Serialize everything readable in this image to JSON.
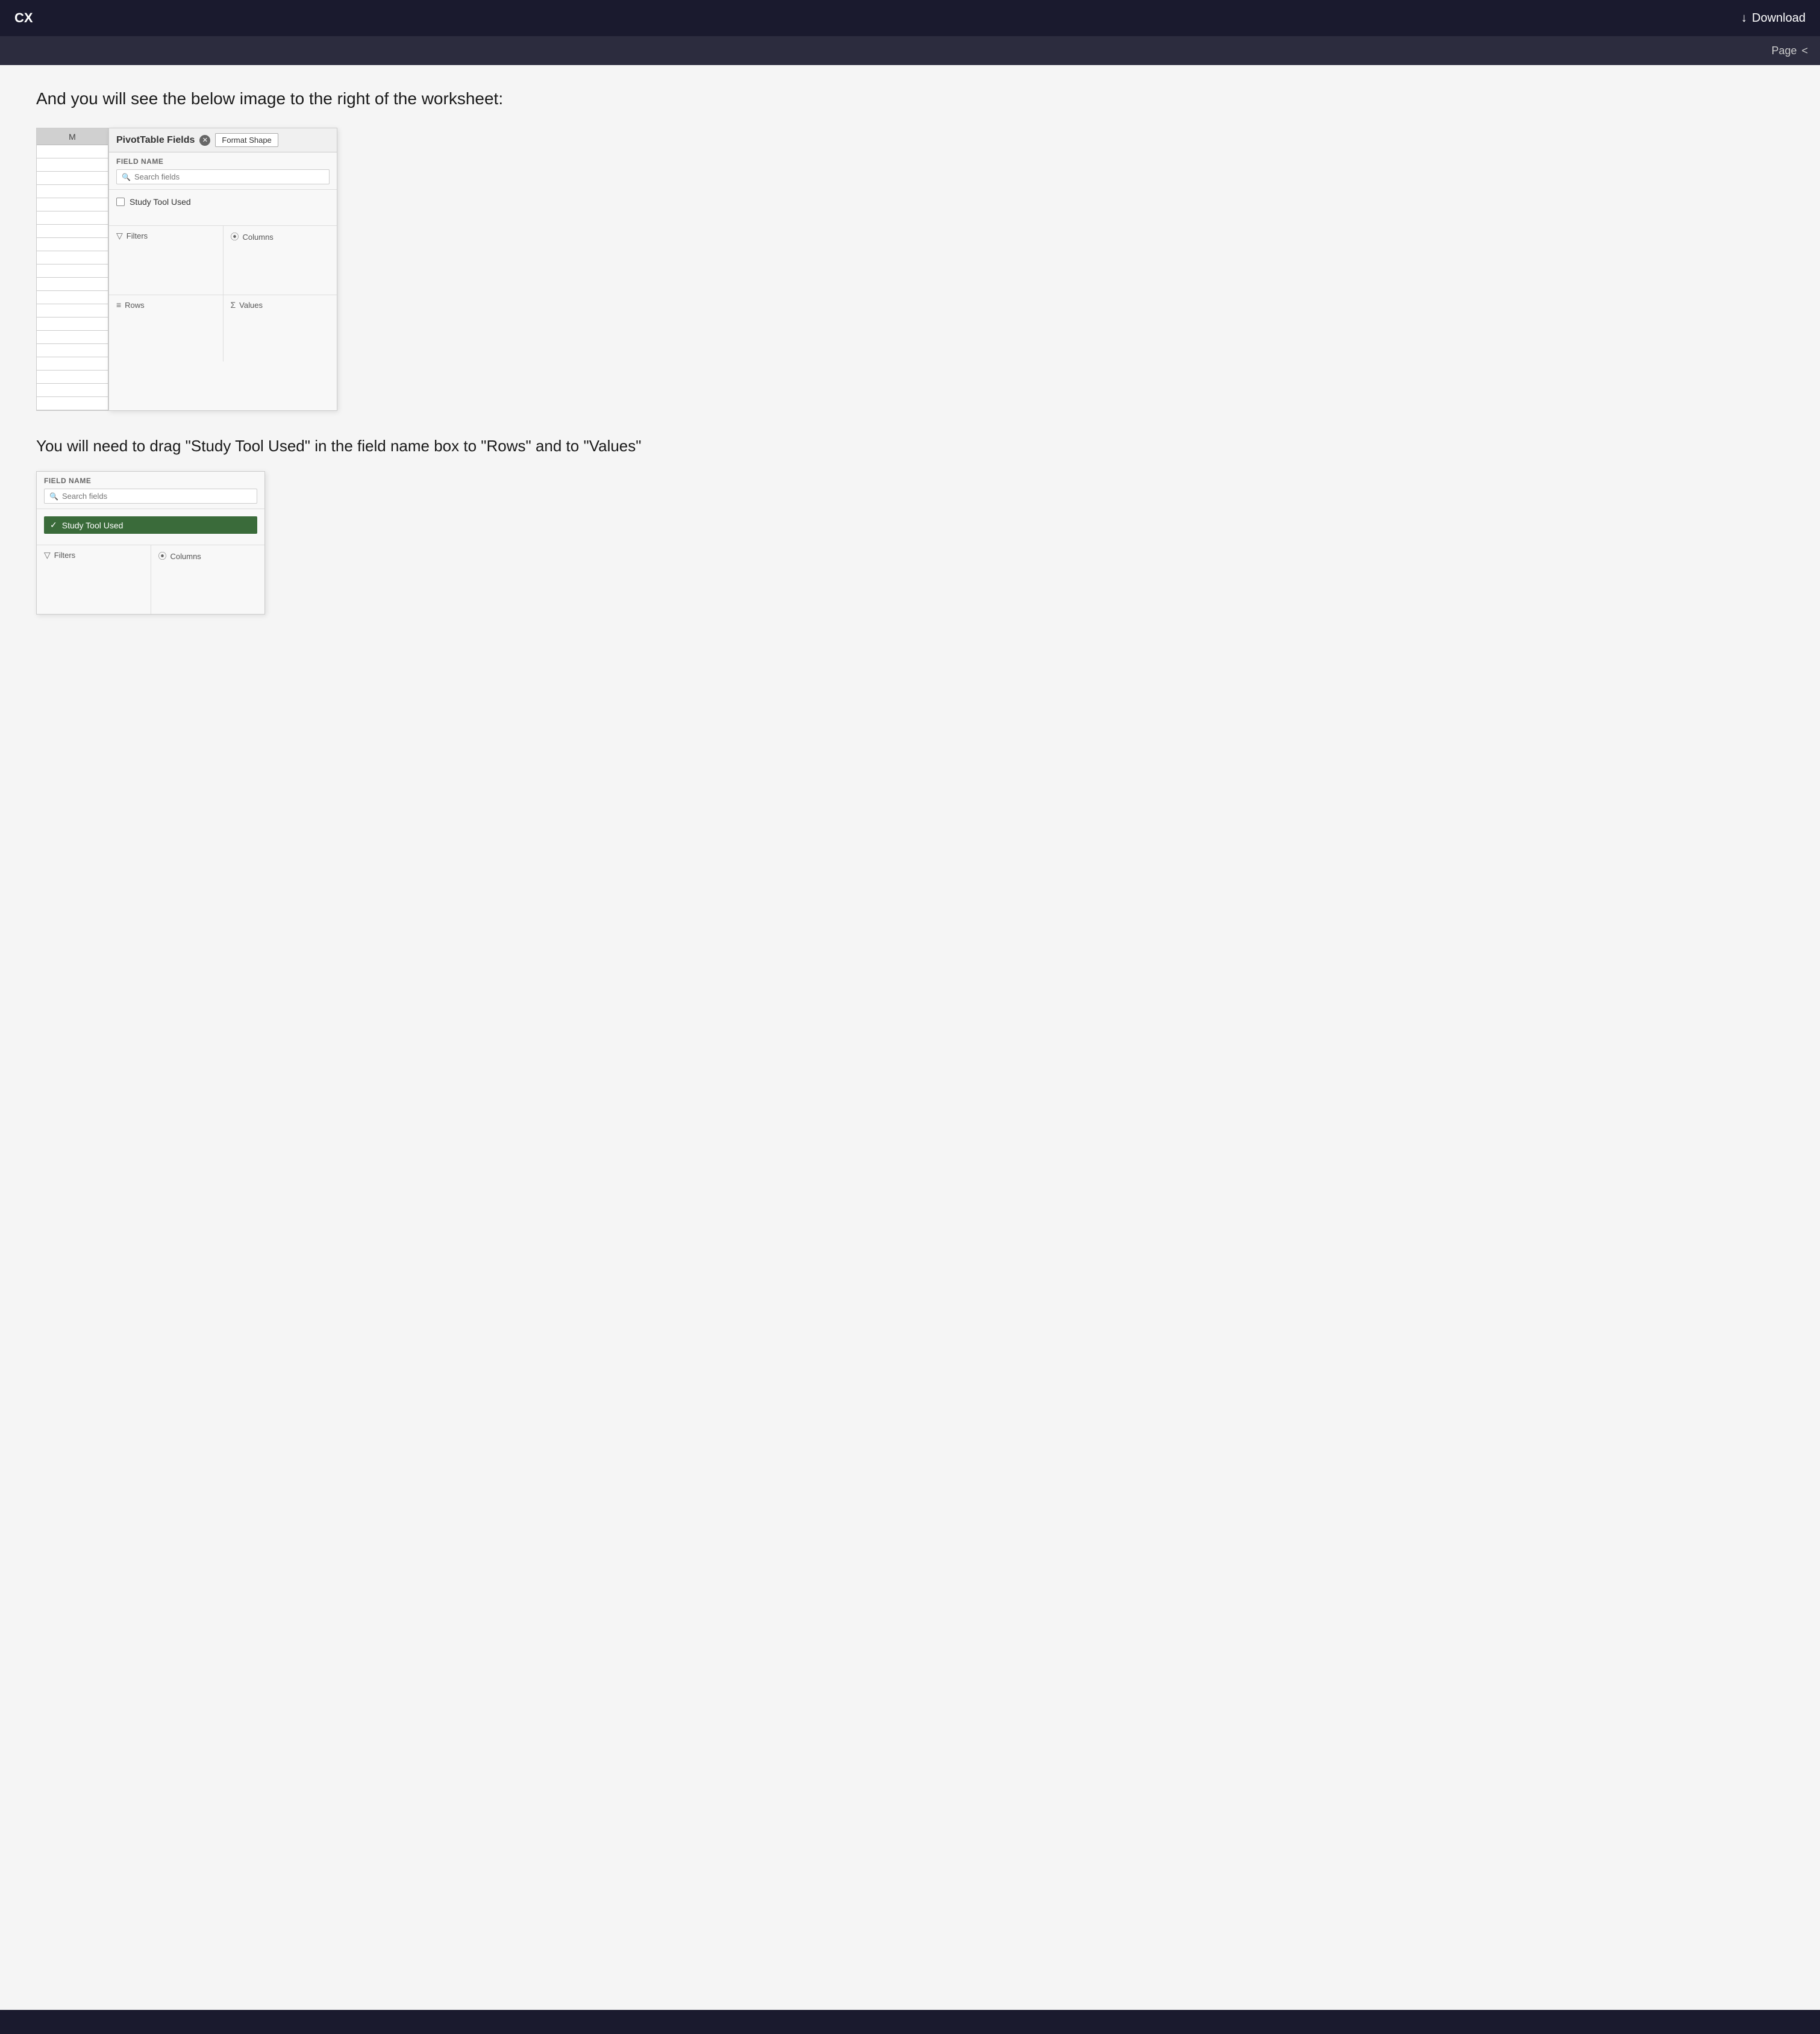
{
  "header": {
    "left_label": "CX",
    "download_label": "Download",
    "download_icon": "↓",
    "page_label": "Page",
    "chevron": "<"
  },
  "intro": {
    "text": "And you will see the below image to the right of the worksheet:"
  },
  "pivot_panel_1": {
    "title": "PivotTable Fields",
    "format_shape_label": "Format Shape",
    "field_name_label": "FIELD NAME",
    "search_placeholder": "Search fields",
    "field_item": "Study Tool Used",
    "filters_label": "Filters",
    "columns_label": "Columns",
    "rows_label": "Rows",
    "values_label": "Values",
    "col_header": "M"
  },
  "instruction": {
    "text": "You will need to drag \"Study Tool Used\" in the field name box to \"Rows\" and to \"Values\""
  },
  "pivot_panel_2": {
    "field_name_label": "FIELD NAME",
    "search_placeholder": "Search fields",
    "field_item_checked": "Study Tool Used",
    "filters_label": "Filters",
    "columns_label": "Columns"
  }
}
